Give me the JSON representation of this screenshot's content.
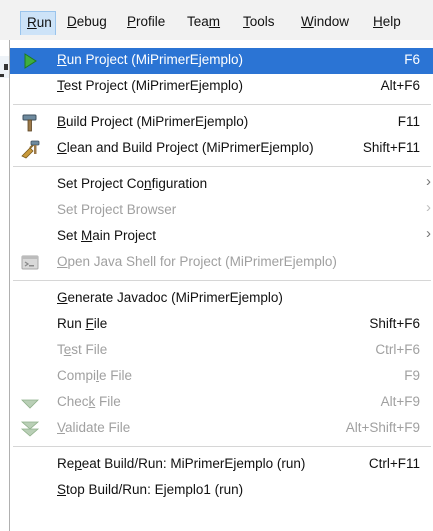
{
  "menubar": {
    "items": [
      {
        "label": "Run",
        "mnemonic": "R",
        "active": true
      },
      {
        "label": "Debug",
        "mnemonic": "D"
      },
      {
        "label": "Profile",
        "mnemonic": "P"
      },
      {
        "label": "Team",
        "mnemonic": "m"
      },
      {
        "label": "Tools",
        "mnemonic": "T"
      },
      {
        "label": "Window",
        "mnemonic": "W"
      },
      {
        "label": "Help",
        "mnemonic": "H"
      }
    ]
  },
  "colors": {
    "highlight": "#2b74d4",
    "disabled_text": "#a0a0a0",
    "menubar_bg": "#f2f2f2",
    "active_menu_bg": "#cde3f8"
  },
  "run_menu": {
    "groups": [
      [
        {
          "label": "Run Project (MiPrimerEjemplo)",
          "mnemonic": "R",
          "shortcut": "F6",
          "icon": "run-triangle-icon",
          "highlighted": true
        },
        {
          "label": "Test Project (MiPrimerEjemplo)",
          "mnemonic": "T",
          "shortcut": "Alt+F6"
        }
      ],
      [
        {
          "label": "Build Project (MiPrimerEjemplo)",
          "mnemonic": "B",
          "shortcut": "F11",
          "icon": "hammer-icon"
        },
        {
          "label": "Clean and Build Project (MiPrimerEjemplo)",
          "mnemonic": "C",
          "shortcut": "Shift+F11",
          "icon": "broom-hammer-icon"
        }
      ],
      [
        {
          "label": "Set Project Configuration",
          "mnemonic": "n",
          "submenu": true
        },
        {
          "label": "Set Project Browser",
          "disabled": true,
          "submenu": true
        },
        {
          "label": "Set Main Project",
          "mnemonic": "M",
          "submenu": true
        },
        {
          "label": "Open Java Shell for Project (MiPrimerEjemplo)",
          "mnemonic": "O",
          "disabled": true,
          "icon": "java-shell-icon"
        }
      ],
      [
        {
          "label": "Generate Javadoc (MiPrimerEjemplo)",
          "mnemonic": "G"
        },
        {
          "label": "Run File",
          "mnemonic": "F",
          "shortcut": "Shift+F6"
        },
        {
          "label": "Test File",
          "mnemonic": "e",
          "shortcut": "Ctrl+F6",
          "disabled": true
        },
        {
          "label": "Compile File",
          "mnemonic": "l",
          "shortcut": "F9",
          "disabled": true
        },
        {
          "label": "Check File",
          "mnemonic": "k",
          "shortcut": "Alt+F9",
          "disabled": true,
          "icon": "check-file-icon"
        },
        {
          "label": "Validate File",
          "mnemonic": "V",
          "shortcut": "Alt+Shift+F9",
          "disabled": true,
          "icon": "validate-file-icon"
        }
      ],
      [
        {
          "label": "Repeat Build/Run: MiPrimerEjemplo (run)",
          "mnemonic": "p",
          "shortcut": "Ctrl+F11"
        },
        {
          "label": "Stop Build/Run: Ejemplo1 (run)",
          "mnemonic": "S"
        }
      ]
    ]
  }
}
